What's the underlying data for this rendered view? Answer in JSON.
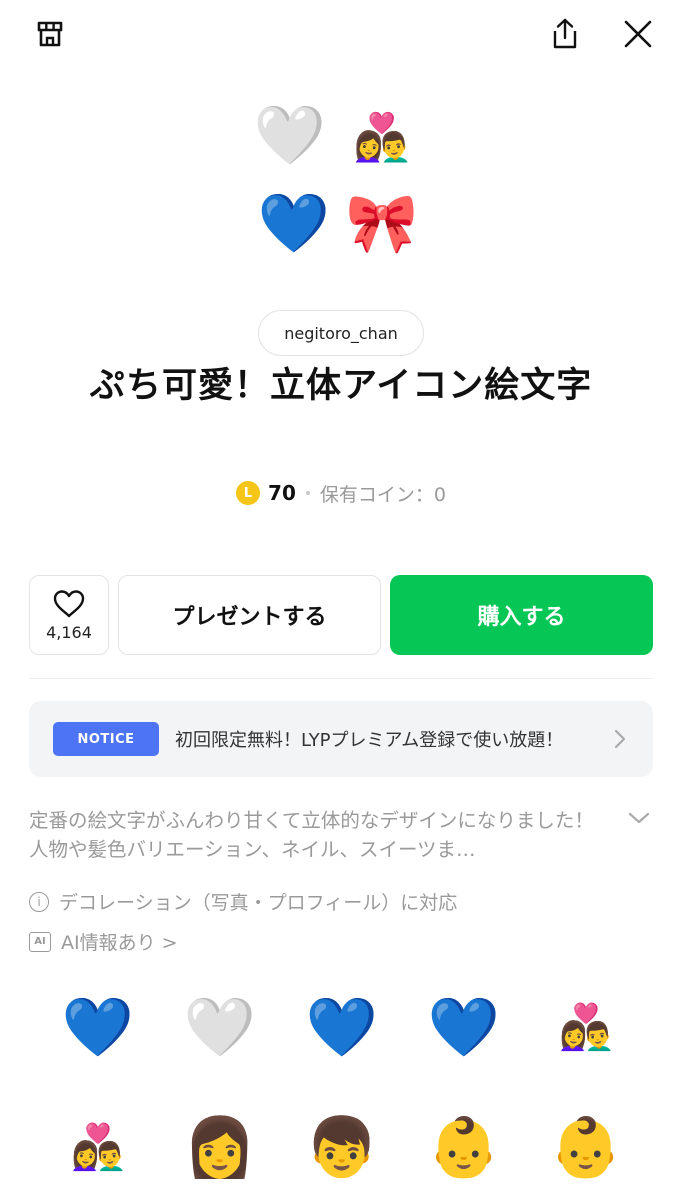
{
  "topbar": {
    "shop_icon": "shop-icon",
    "share_icon": "share-icon",
    "close_icon": "close-icon"
  },
  "preview": {
    "emojis": [
      "🤍",
      "👩‍❤️‍👨",
      "💙",
      "🎀"
    ]
  },
  "product": {
    "author": "negitoro_chan",
    "title": "ぷち可愛！立体アイコン絵文字",
    "coin_badge": "L",
    "price": "70",
    "owned_coins": "保有コイン：0"
  },
  "actions": {
    "like_count": "4,164",
    "present_label": "プレゼントする",
    "buy_label": "購入する",
    "buy_color": "#06c755"
  },
  "notice": {
    "badge": "NOTICE",
    "text": "初回限定無料！LYPプレミアム登録で使い放題！",
    "badge_color": "#4d74f5"
  },
  "description": {
    "text": "定番の絵文字がふんわり甘くて立体的なデザインになりました！人物や髪色バリエーション、ネイル、スイーツま…"
  },
  "info": {
    "decoration": "デコレーション（写真・プロフィール）に対応",
    "ai_badge": "AI",
    "ai_info": "AI情報あり >"
  },
  "grid": {
    "rows": [
      [
        "💙",
        "🤍",
        "💙",
        "💙",
        "👩‍❤️‍👨"
      ],
      [
        "👩‍❤️‍👨",
        "👩",
        "👦",
        "👶",
        "👶"
      ]
    ]
  }
}
